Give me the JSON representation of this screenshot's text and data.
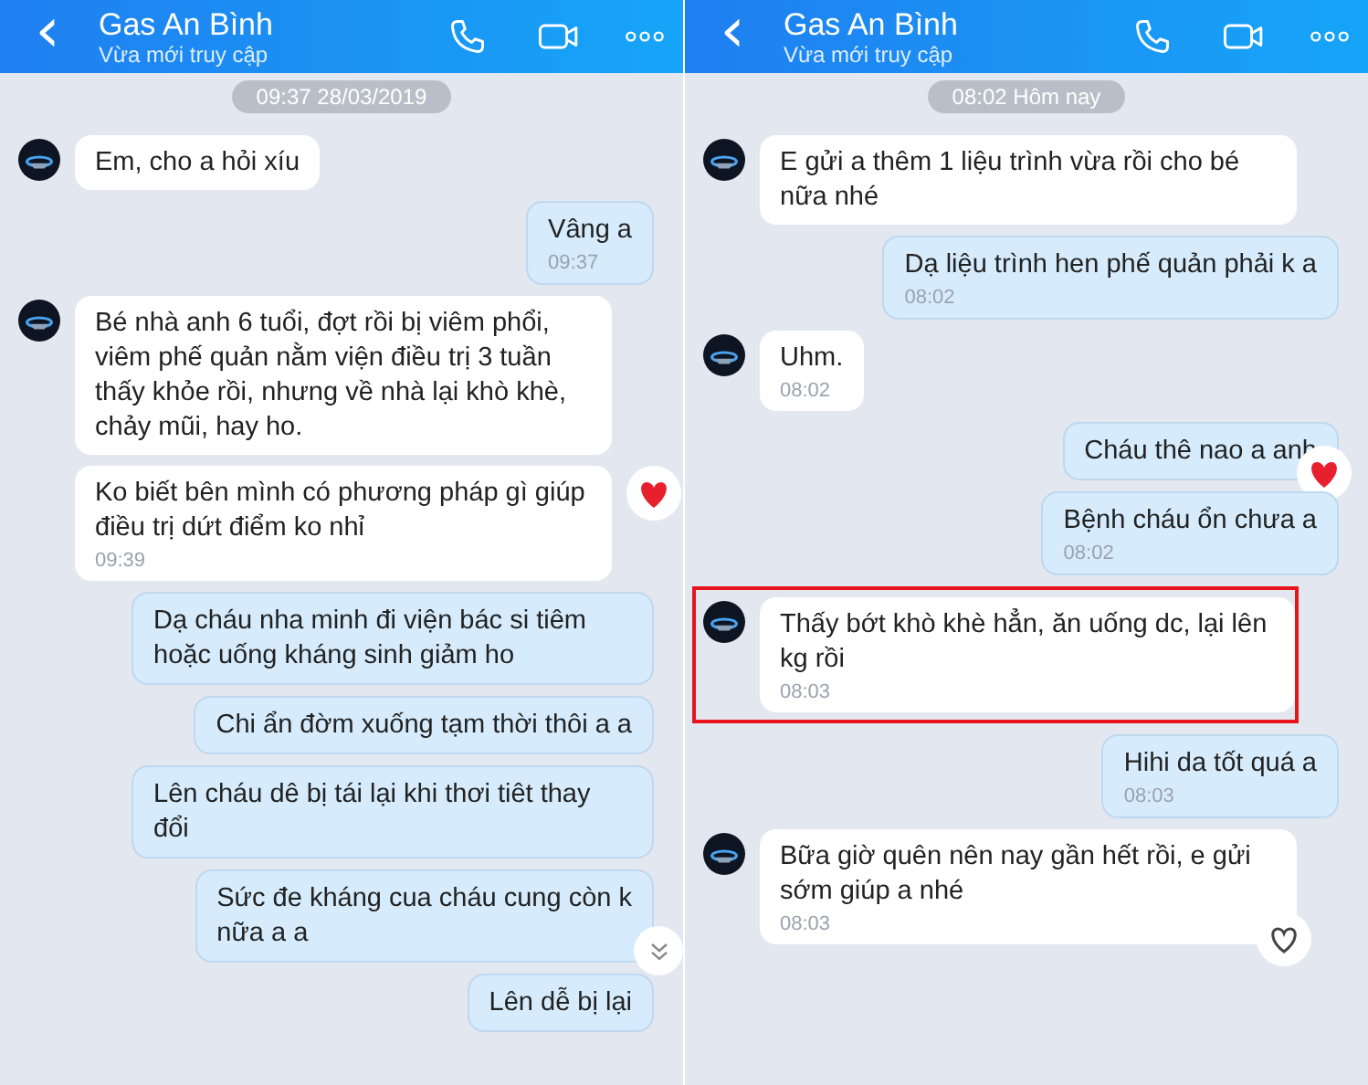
{
  "panels": [
    {
      "header": {
        "back": "‹",
        "title": "Gas An Bình",
        "subtitle": "Vừa mới truy cập"
      },
      "date_label": "09:37 28/03/2019",
      "scroll_down_button": true,
      "messages": [
        {
          "kind": "incoming",
          "avatar": true,
          "text": "Em, cho a hỏi xíu",
          "highlighted": false
        },
        {
          "kind": "outgoing",
          "text": "Vâng a",
          "time": "09:37",
          "highlighted": false
        },
        {
          "kind": "incoming",
          "avatar": true,
          "text": "Bé nhà anh 6 tuổi, đợt rồi bị viêm phổi, viêm phế quản nằm viện điều trị 3 tuần thấy khỏe rồi, nhưng về nhà lại khò khè, chảy mũi, hay ho.",
          "highlighted": false
        },
        {
          "kind": "incoming",
          "avatar": false,
          "text": "Ko biết bên mình có phương pháp gì giúp điều trị dứt điểm ko nhỉ",
          "time": "09:39",
          "reaction": {
            "kind": "heart"
          },
          "highlighted": false
        },
        {
          "kind": "outgoing",
          "text": "Dạ cháu nha minh đi viện bác si tiêm hoặc uống kháng sinh giảm ho",
          "highlighted": false
        },
        {
          "kind": "outgoing",
          "text": "Chi ẩn đờm xuống tạm thời thôi a a",
          "highlighted": false
        },
        {
          "kind": "outgoing",
          "text": "Lên cháu dê bị tái lại khi thơi tiêt thay đổi",
          "highlighted": false
        },
        {
          "kind": "outgoing",
          "text": "Sức đe kháng cua cháu cung còn k\nnữa a a",
          "highlighted": false
        },
        {
          "kind": "outgoing",
          "text": "Lên dễ bị lại",
          "highlighted": false
        }
      ]
    },
    {
      "header": {
        "back": "‹",
        "title": "Gas An Bình",
        "subtitle": "Vừa mới truy cập"
      },
      "date_label": "08:02 Hôm nay",
      "messages": [
        {
          "kind": "incoming",
          "avatar": true,
          "text": "E gửi a thêm 1 liệu trình vừa rồi cho bé nữa nhé",
          "highlighted": false
        },
        {
          "kind": "outgoing",
          "text": "Dạ liệu trình hen phế quản phải k a",
          "time": "08:02",
          "highlighted": false
        },
        {
          "kind": "incoming",
          "avatar": true,
          "text": "Uhm.",
          "time": "08:02",
          "highlighted": false
        },
        {
          "kind": "outgoing",
          "text": "Cháu thê nao a anh",
          "reaction": {
            "kind": "heart"
          },
          "highlighted": false
        },
        {
          "kind": "outgoing",
          "text": "Bệnh cháu ổn chưa a",
          "time": "08:02",
          "highlighted": false
        },
        {
          "kind": "incoming",
          "avatar": true,
          "text": "Thấy bớt khò khè hẳn, ăn uống dc, lại lên kg rồi",
          "time": "08:03",
          "highlighted": true
        },
        {
          "kind": "outgoing",
          "text": "Hihi da tốt quá a",
          "time": "08:03",
          "highlighted": false
        },
        {
          "kind": "incoming",
          "avatar": true,
          "text": "Bữa giờ quên nên nay gần hết rồi, e gửi sớm giúp a nhé",
          "time": "08:03",
          "reaction": {
            "kind": "heart-outline"
          },
          "highlighted": false
        }
      ]
    }
  ]
}
